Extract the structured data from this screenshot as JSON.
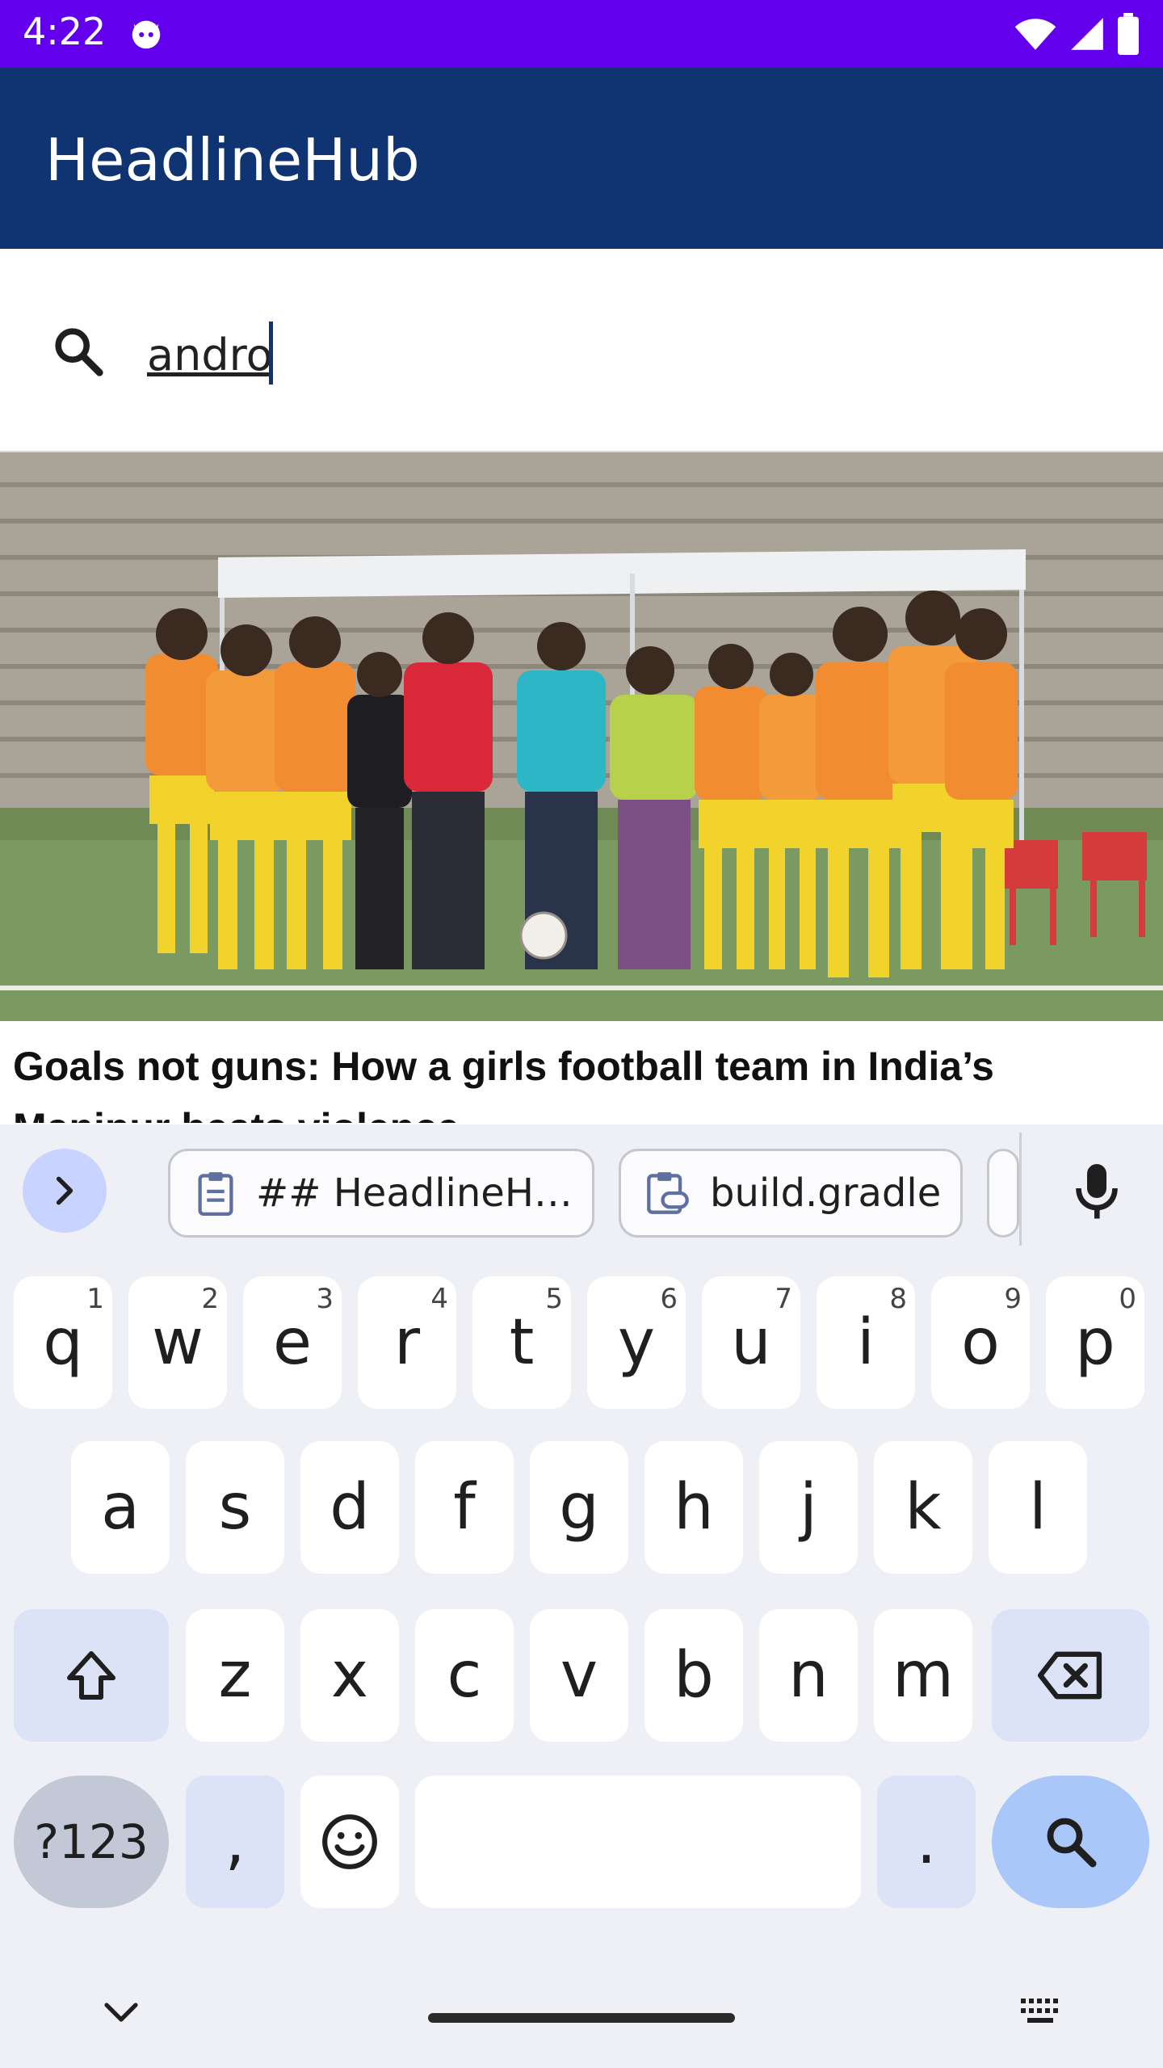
{
  "status_bar": {
    "time": "4:22",
    "bg_color": "#6200ee",
    "icons": [
      "cat-notification-icon",
      "wifi-icon",
      "signal-icon",
      "battery-icon"
    ]
  },
  "app_bar": {
    "title": "HeadlineHub",
    "bg_color": "#0f3471"
  },
  "search": {
    "icon": "search-icon",
    "value": "andro"
  },
  "article": {
    "image_icon": "news-photo",
    "headline": "Goals not guns: How a girls football team in India’s Manipur beats violence"
  },
  "keyboard": {
    "suggestions": [
      {
        "icon": "clipboard-icon",
        "label": "## HeadlineH…"
      },
      {
        "icon": "clipboard-link-icon",
        "label": "build.gradle"
      }
    ],
    "row1": [
      {
        "label": "q",
        "hint": "1"
      },
      {
        "label": "w",
        "hint": "2"
      },
      {
        "label": "e",
        "hint": "3"
      },
      {
        "label": "r",
        "hint": "4"
      },
      {
        "label": "t",
        "hint": "5"
      },
      {
        "label": "y",
        "hint": "6"
      },
      {
        "label": "u",
        "hint": "7"
      },
      {
        "label": "i",
        "hint": "8"
      },
      {
        "label": "o",
        "hint": "9"
      },
      {
        "label": "p",
        "hint": "0"
      }
    ],
    "row2": [
      "a",
      "s",
      "d",
      "f",
      "g",
      "h",
      "j",
      "k",
      "l"
    ],
    "row3": [
      "z",
      "x",
      "c",
      "v",
      "b",
      "n",
      "m"
    ],
    "symbols_label": "?123",
    "comma_label": ",",
    "period_label": ".",
    "action_icon": "search-icon",
    "accent_color": "#aac7fa"
  }
}
